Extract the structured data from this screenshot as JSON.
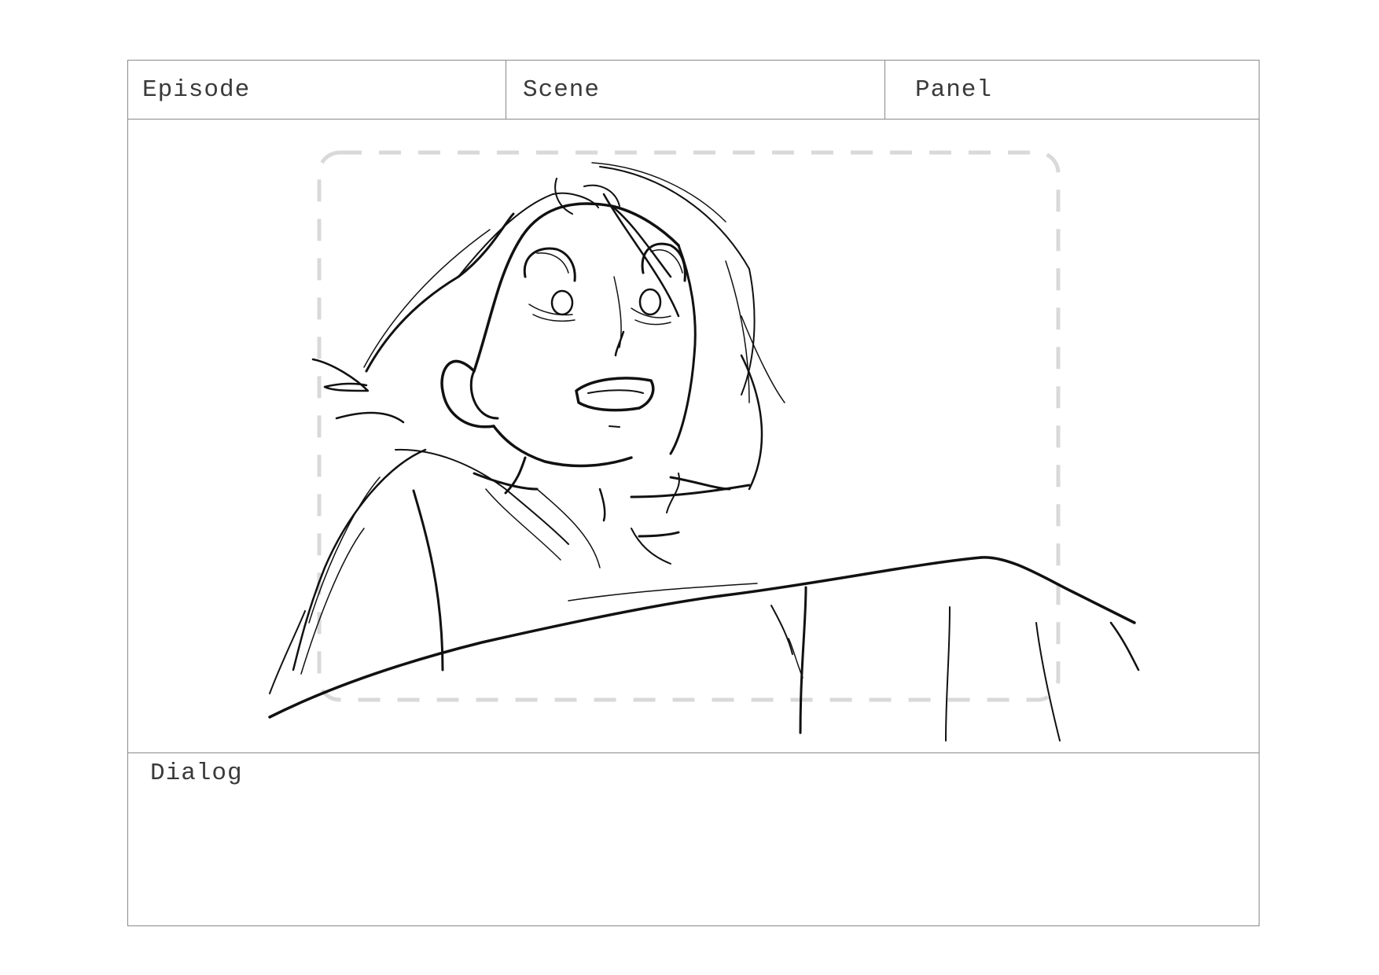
{
  "header": {
    "episode_label": "Episode",
    "scene_label": "Scene",
    "panel_label": "Panel"
  },
  "dialog": {
    "label": "Dialog"
  },
  "colors": {
    "border": "#8a8a8a",
    "safe_area": "#d9d9d9",
    "ink": "#111111"
  }
}
